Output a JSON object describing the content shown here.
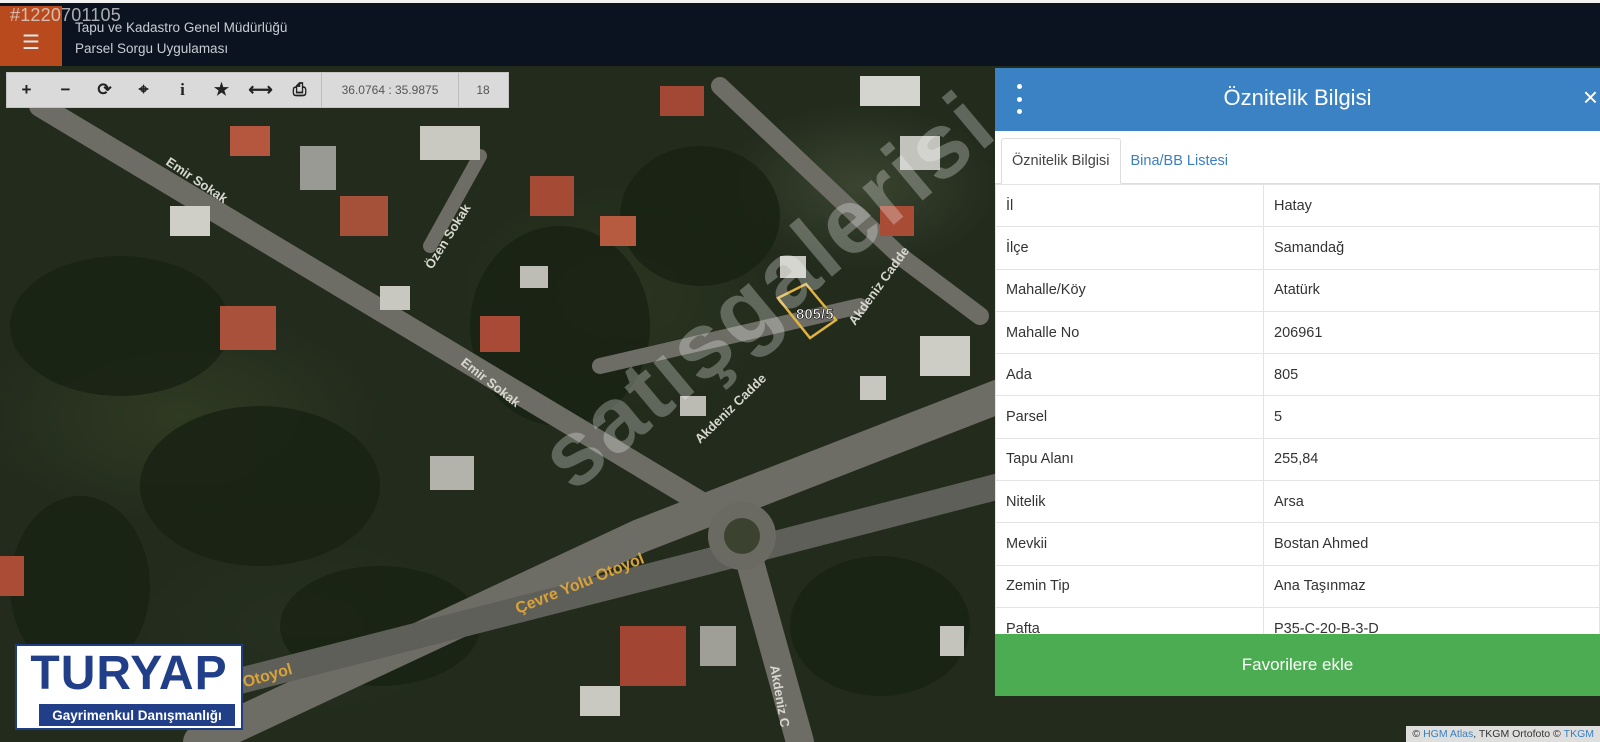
{
  "header": {
    "listing_id": "#1220701105",
    "title_line1": "Tapu ve Kadastro Genel Müdürlüğü",
    "title_line2": "Parsel Sorgu Uygulaması",
    "menu_icon": "hamburger-icon"
  },
  "toolbar": {
    "buttons": [
      {
        "icon": "zoom-in-icon",
        "glyph": "+"
      },
      {
        "icon": "zoom-out-icon",
        "glyph": "−"
      },
      {
        "icon": "refresh-icon",
        "glyph": "⟳"
      },
      {
        "icon": "locate-icon",
        "glyph": "⌖"
      },
      {
        "icon": "info-icon",
        "glyph": "i"
      },
      {
        "icon": "star-icon",
        "glyph": "★"
      },
      {
        "icon": "measure-icon",
        "glyph": "⟷"
      },
      {
        "icon": "print-icon",
        "glyph": "⎙"
      }
    ],
    "coords": "36.0764 : 35.9875",
    "zoom": "18"
  },
  "map": {
    "labels": {
      "emir1": "Emir Sokak",
      "ozen": "Özen Sokak",
      "emir2": "Emir Sokak",
      "akdeniz1": "Akdeniz Cadde",
      "akdeniz2": "Akdeniz Cadde",
      "cevre1": "Çevre Yolu Otoyol",
      "cevre2": "Yolu Otoyol",
      "akdeniz3": "Akdeniz C",
      "parcel": "805/5"
    },
    "watermark": "satışgalerisi"
  },
  "panel": {
    "title": "Öznitelik Bilgisi",
    "close": "×",
    "tabs": [
      "Öznitelik Bilgisi",
      "Bina/BB Listesi"
    ],
    "rows": [
      {
        "key": "İl",
        "value": "Hatay"
      },
      {
        "key": "İlçe",
        "value": "Samandağ"
      },
      {
        "key": "Mahalle/Köy",
        "value": "Atatürk"
      },
      {
        "key": "Mahalle No",
        "value": "206961"
      },
      {
        "key": "Ada",
        "value": "805"
      },
      {
        "key": "Parsel",
        "value": "5"
      },
      {
        "key": "Tapu Alanı",
        "value": "255,84"
      },
      {
        "key": "Nitelik",
        "value": "Arsa"
      },
      {
        "key": "Mevkii",
        "value": "Bostan Ahmed"
      },
      {
        "key": "Zemin Tip",
        "value": "Ana Taşınmaz"
      },
      {
        "key": "Pafta",
        "value": "P35-C-20-B-3-D"
      }
    ],
    "favorite_button": "Favorilere ekle"
  },
  "logo": {
    "main": "TURYAP",
    "sub": "Gayrimenkul Danışmanlığı"
  },
  "attribution": {
    "prefix": "©",
    "hgm": "HGM Atlas",
    "mid": ", TKGM Ortofoto ©",
    "tkgm": "TKGM"
  }
}
